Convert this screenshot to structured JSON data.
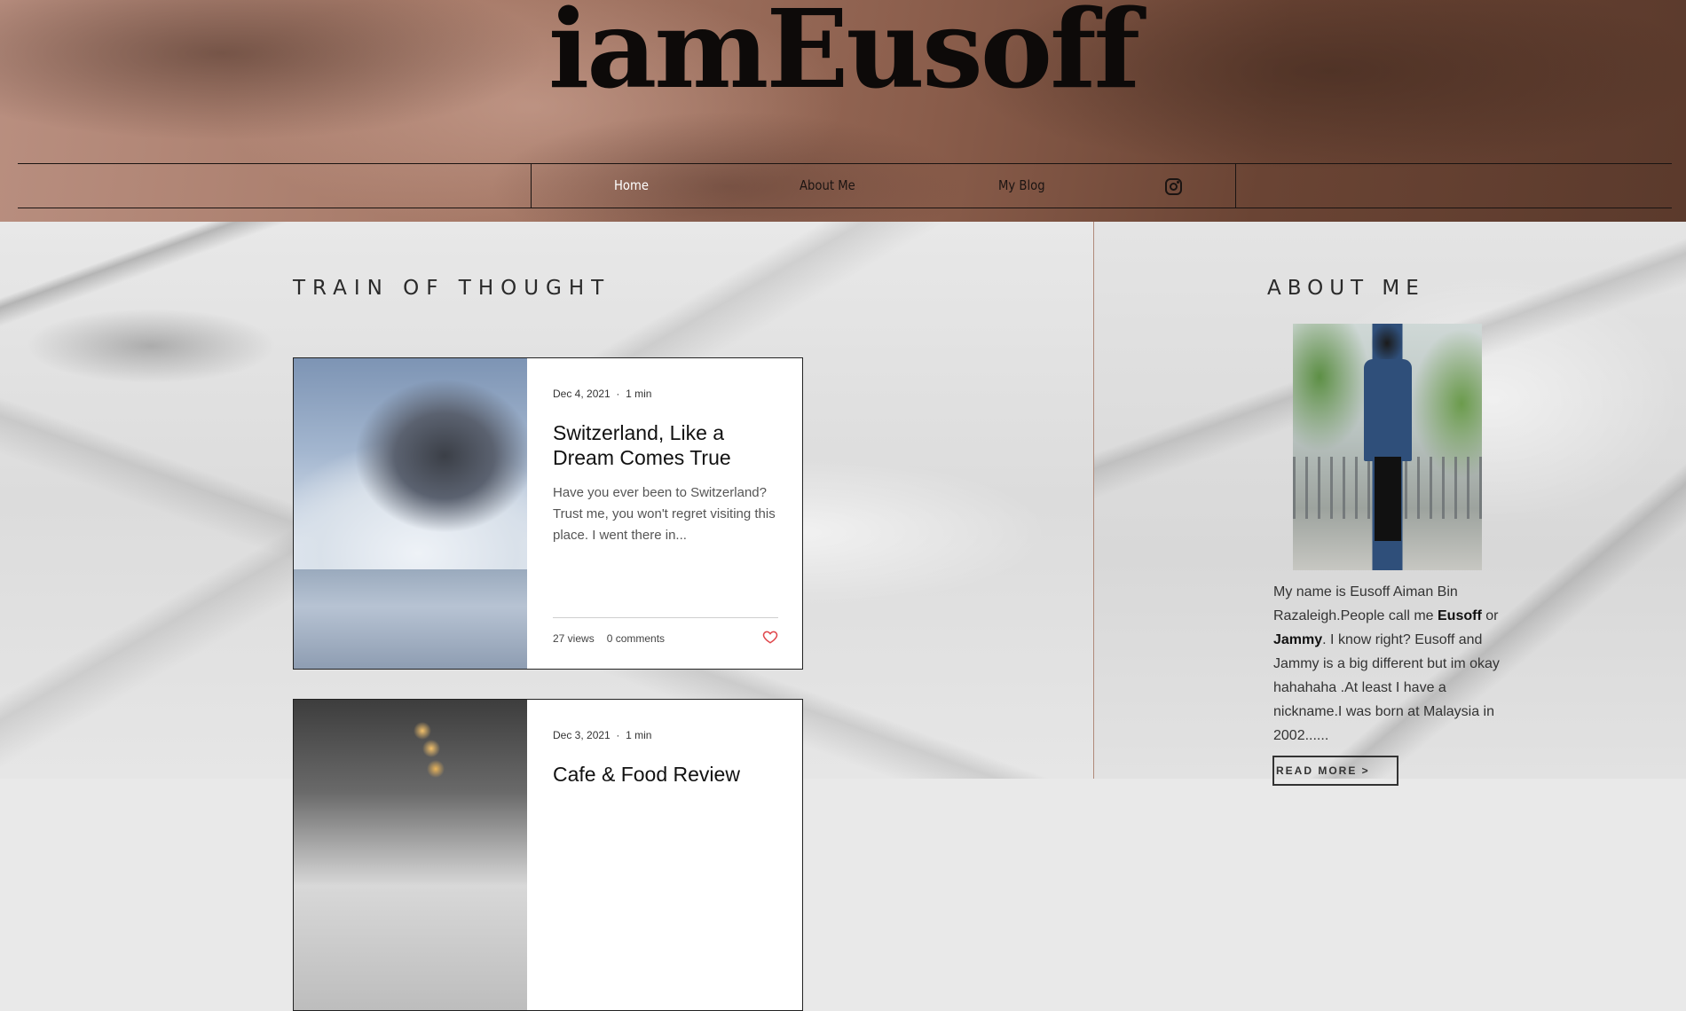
{
  "site": {
    "title": "iamEusoff"
  },
  "nav": {
    "items": [
      {
        "label": "Home",
        "active": true
      },
      {
        "label": "About Me",
        "active": false
      },
      {
        "label": "My Blog",
        "active": false
      }
    ],
    "social_icon": "instagram-icon"
  },
  "blog": {
    "section_title": "TRAIN OF THOUGHT",
    "posts": [
      {
        "date": "Dec 4, 2021",
        "read_time": "1 min",
        "title": "Switzerland, Like a Dream Comes True",
        "excerpt": "Have you ever been to Switzerland? Trust me, you won't regret visiting this place. I went there in...",
        "views": "27 views",
        "comments": "0 comments",
        "like_icon": "heart-icon",
        "image": "snowy-mountain"
      },
      {
        "date": "Dec 3, 2021",
        "read_time": "1 min",
        "title": "Cafe & Food Review",
        "image": "cafe-interior"
      }
    ]
  },
  "about": {
    "section_title": "ABOUT ME",
    "text_part1": "My name is Eusoff Aiman Bin Razaleigh.People call me ",
    "name_bold1": "Eusoff",
    "text_part2": " or ",
    "name_bold2": "Jammy",
    "text_part3": ". I know right? Eusoff and Jammy is a big different but im okay hahahaha .At least I have a nickname.I was born at Malaysia in 2002......",
    "read_more": "READ MORE >"
  },
  "colors": {
    "header_brown": "#8a5d4b",
    "accent_divider": "#b08a7a",
    "like_red": "#e0474c"
  }
}
